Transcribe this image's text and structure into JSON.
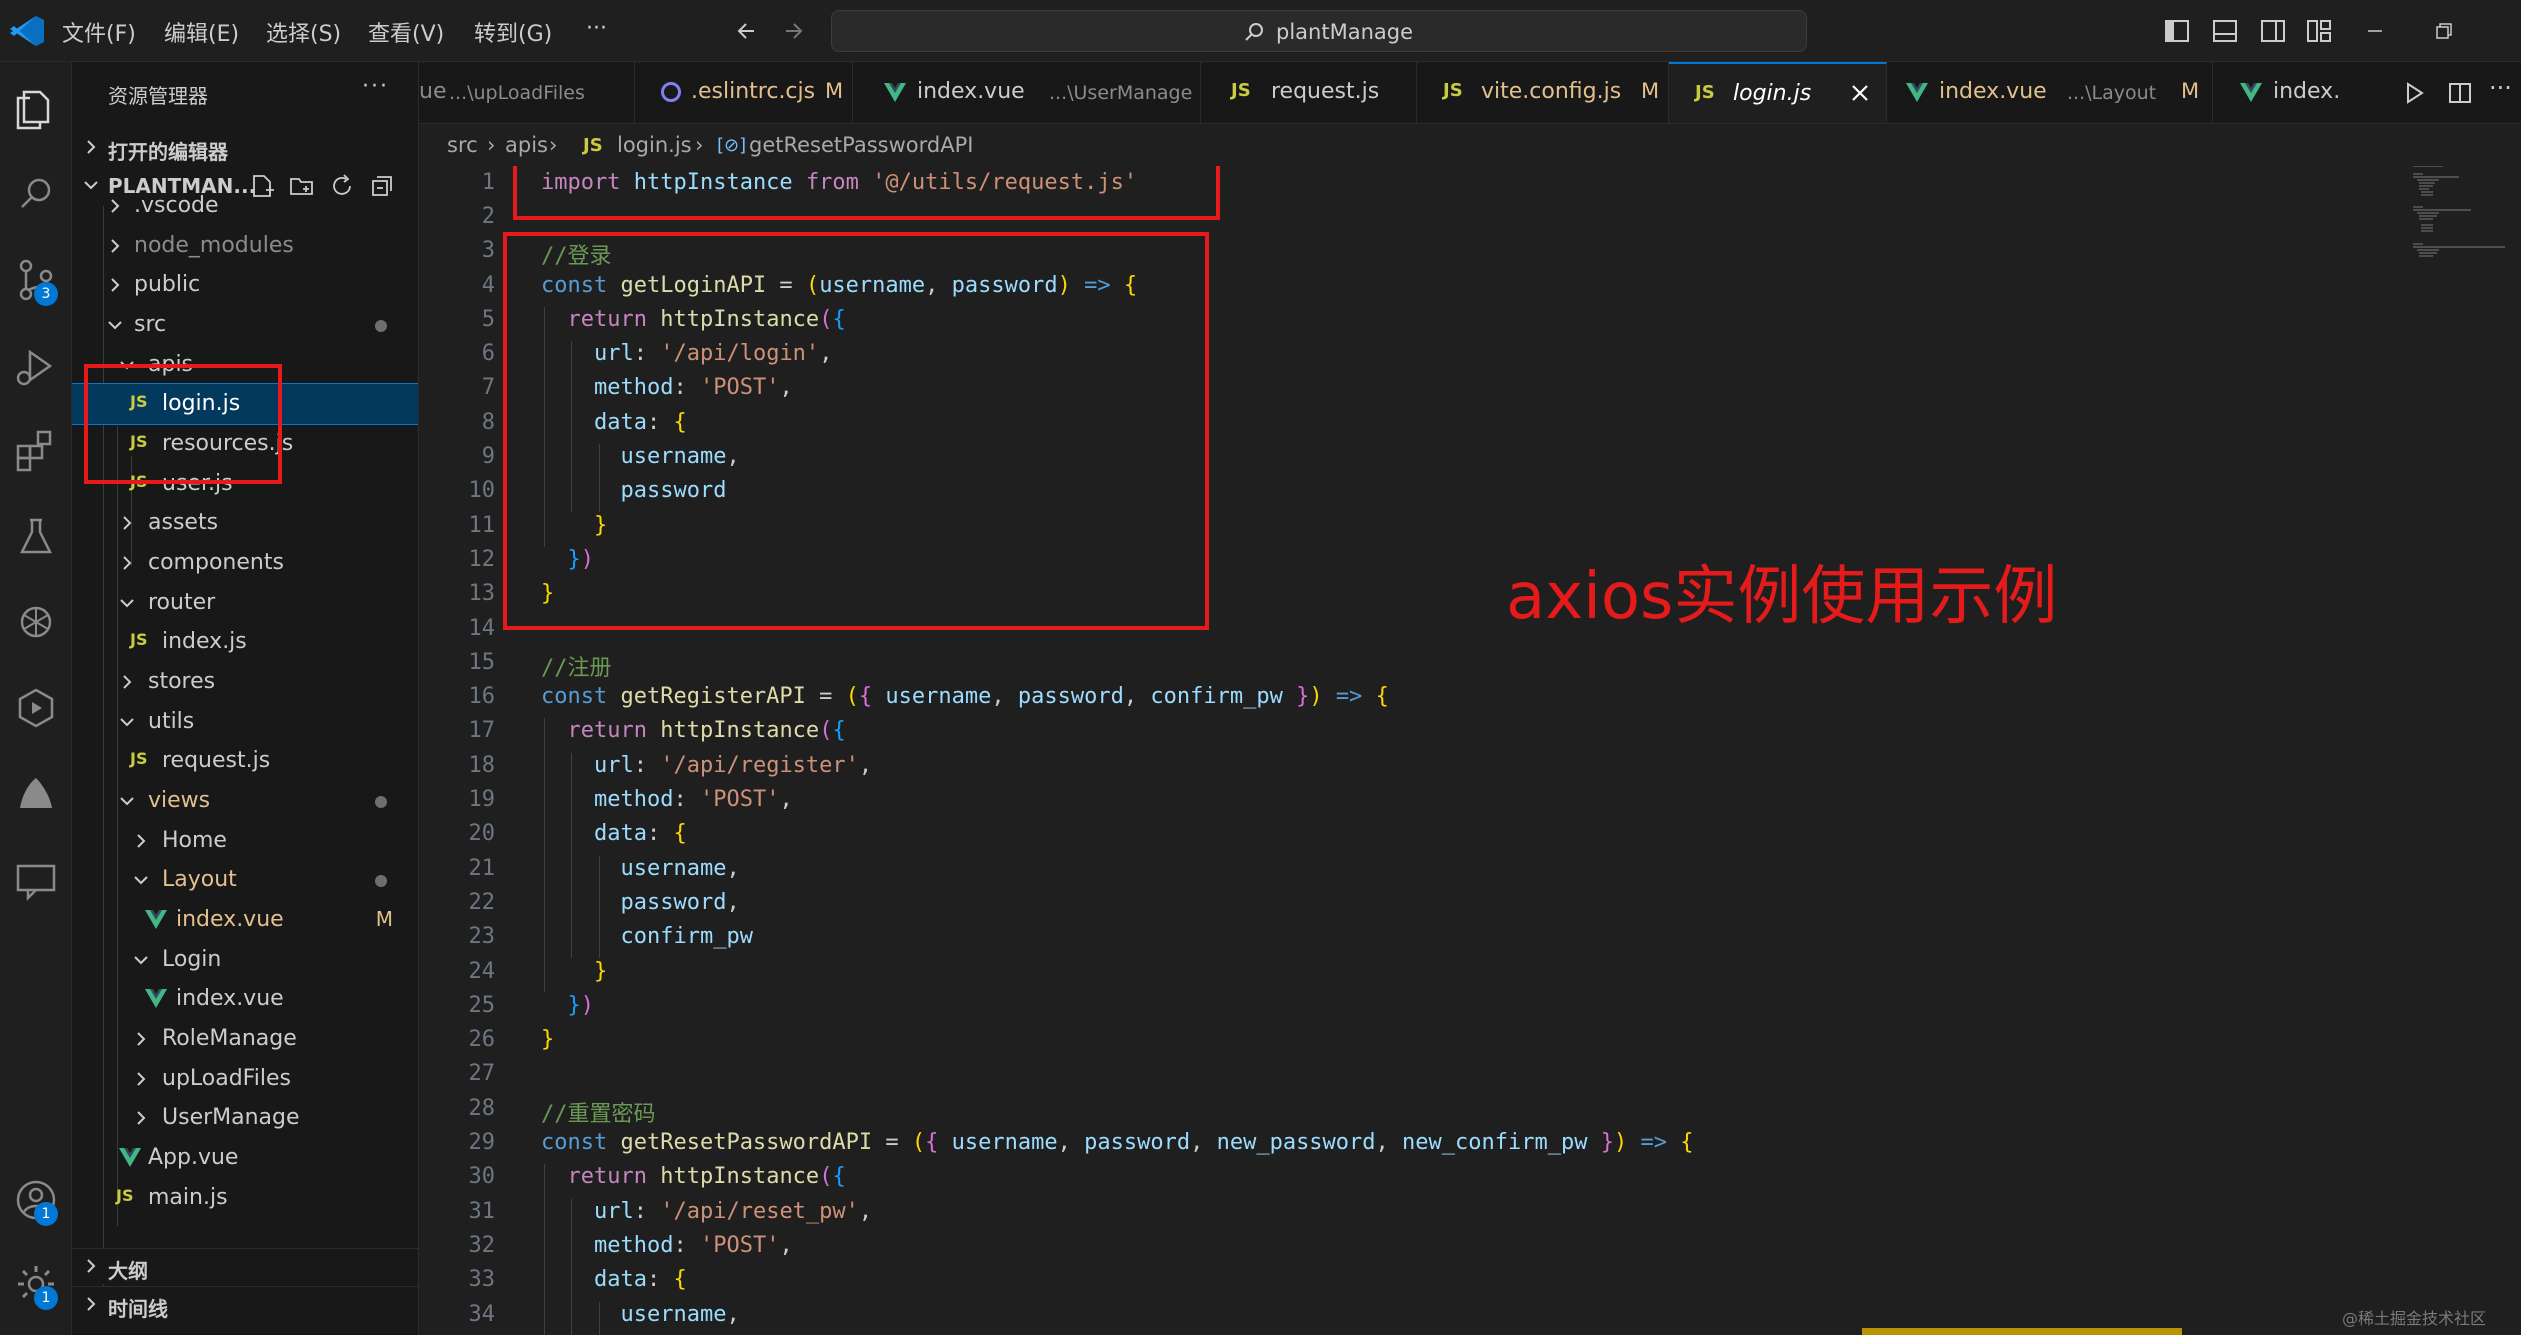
{
  "titlebar": {
    "menus": [
      "文件(F)",
      "编辑(E)",
      "选择(S)",
      "查看(V)",
      "转到(G)",
      "···"
    ],
    "search_text": "plantManage"
  },
  "activity": {
    "scm_badge": "3",
    "account_badge": "1",
    "manage_badge": "1"
  },
  "sidebar": {
    "title": "资源管理器",
    "more": "···",
    "open_editors": "打开的编辑器",
    "project": "PLANTMAN...",
    "outline": "大纲",
    "timeline": "时间线",
    "tree": [
      {
        "label": ".vscode"
      },
      {
        "label": "node_modules"
      },
      {
        "label": "public"
      },
      {
        "label": "src"
      },
      {
        "label": "apis"
      },
      {
        "label": "login.js",
        "icon": "JS"
      },
      {
        "label": "resources.js",
        "icon": "JS"
      },
      {
        "label": "user.js",
        "icon": "JS"
      },
      {
        "label": "assets"
      },
      {
        "label": "components"
      },
      {
        "label": "router"
      },
      {
        "label": "index.js",
        "icon": "JS"
      },
      {
        "label": "stores"
      },
      {
        "label": "utils"
      },
      {
        "label": "request.js",
        "icon": "JS"
      },
      {
        "label": "views"
      },
      {
        "label": "Home"
      },
      {
        "label": "Layout"
      },
      {
        "label": "index.vue",
        "decoration": "M"
      },
      {
        "label": "Login"
      },
      {
        "label": "index.vue"
      },
      {
        "label": "RoleManage"
      },
      {
        "label": "upLoadFiles"
      },
      {
        "label": "UserManage"
      },
      {
        "label": "App.vue"
      },
      {
        "label": "main.js",
        "icon": "JS"
      }
    ]
  },
  "tabs": [
    {
      "label": "ue",
      "desc": "...\\upLoadFiles"
    },
    {
      "label": ".eslintrc.cjs",
      "mod": "M"
    },
    {
      "label": "index.vue",
      "desc": "...\\UserManage"
    },
    {
      "label": "request.js",
      "icon": "JS"
    },
    {
      "label": "vite.config.js",
      "icon": "JS",
      "mod": "M"
    },
    {
      "label": "login.js",
      "icon": "JS"
    },
    {
      "label": "index.vue",
      "desc": "...\\Layout",
      "mod": "M"
    },
    {
      "label": "index."
    }
  ],
  "breadcrumb": {
    "src": "src",
    "apis": "apis",
    "file_icon": "JS",
    "file": "login.js",
    "symbol": "getResetPasswordAPI"
  },
  "editor": {
    "line_numbers": [
      "1",
      "2",
      "3",
      "4",
      "5",
      "6",
      "7",
      "8",
      "9",
      "10",
      "11",
      "12",
      "13",
      "14",
      "15",
      "16",
      "17",
      "18",
      "19",
      "20",
      "21",
      "22",
      "23",
      "24",
      "25",
      "26",
      "27",
      "28",
      "29",
      "30",
      "31",
      "32",
      "33",
      "34"
    ],
    "annotation": "axios实例使用示例",
    "code": {
      "kw_import": "import",
      "httpInstance": "httpInstance",
      "kw_from": "from",
      "import_path": "'@/utils/request.js'",
      "c_login": "//登录",
      "c_register": "//注册",
      "c_reset": "//重置密码",
      "kw_const": "const",
      "kw_return": "return",
      "fn_login": "getLoginAPI",
      "fn_register": "getRegisterAPI",
      "fn_reset": "getResetPasswordAPI",
      "p_username": "username",
      "p_password": "password",
      "p_confirm": "confirm_pw",
      "p_new_password": "new_password",
      "p_new_confirm": "new_confirm_pw",
      "k_url": "url",
      "k_method": "method",
      "k_data": "data",
      "s_login": "'/api/login'",
      "s_register": "'/api/register'",
      "s_reset": "'/api/reset_pw'",
      "s_post": "'POST'",
      "arrow": "=>"
    }
  },
  "watermark": "@稀土掘金技术社区"
}
